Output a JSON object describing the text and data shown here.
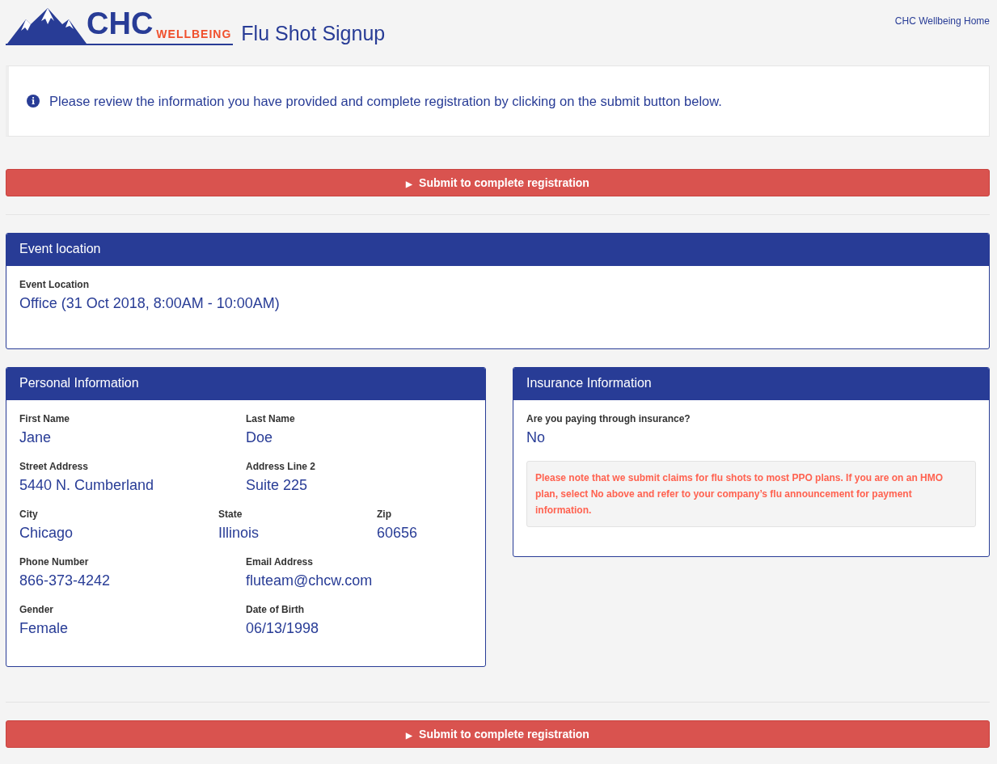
{
  "header": {
    "logo_main": "CHC",
    "logo_sub": "WELLBEING",
    "title": "Flu Shot Signup",
    "home_link": "CHC Wellbeing Home"
  },
  "notice": {
    "icon": "i",
    "text": "Please review the information you have provided and complete registration by clicking on the submit button below."
  },
  "submit_top": {
    "icon": "▶",
    "label": "Submit to complete registration"
  },
  "event_panel": {
    "title": "Event location",
    "label": "Event Location",
    "value": "Office (31 Oct 2018, 8:00AM - 10:00AM)"
  },
  "personal_panel": {
    "title": "Personal Information",
    "rows": [
      [
        {
          "label": "First Name",
          "value": "Jane"
        },
        {
          "label": "Last Name",
          "value": "Doe"
        }
      ],
      [
        {
          "label": "Street Address",
          "value": "5440 N. Cumberland"
        },
        {
          "label": "Address Line 2",
          "value": "Suite 225"
        }
      ],
      [
        {
          "label": "City",
          "value": "Chicago"
        },
        {
          "label": "State",
          "value": "Illinois"
        },
        {
          "label": "Zip",
          "value": "60656"
        }
      ],
      [
        {
          "label": "Phone Number",
          "value": "866-373-4242"
        },
        {
          "label": "Email Address",
          "value": "fluteam@chcw.com"
        }
      ],
      [
        {
          "label": "Gender",
          "value": "Female"
        },
        {
          "label": "Date of Birth",
          "value": "06/13/1998"
        }
      ]
    ]
  },
  "insurance_panel": {
    "title": "Insurance Information",
    "label": "Are you paying through insurance?",
    "value": "No",
    "note": "Please note that we submit claims for flu shots to most PPO plans. If you are on an HMO plan, select No above and refer to your company’s flu announcement for payment information."
  },
  "submit_bottom": {
    "icon": "▶",
    "label": "Submit to complete registration"
  }
}
